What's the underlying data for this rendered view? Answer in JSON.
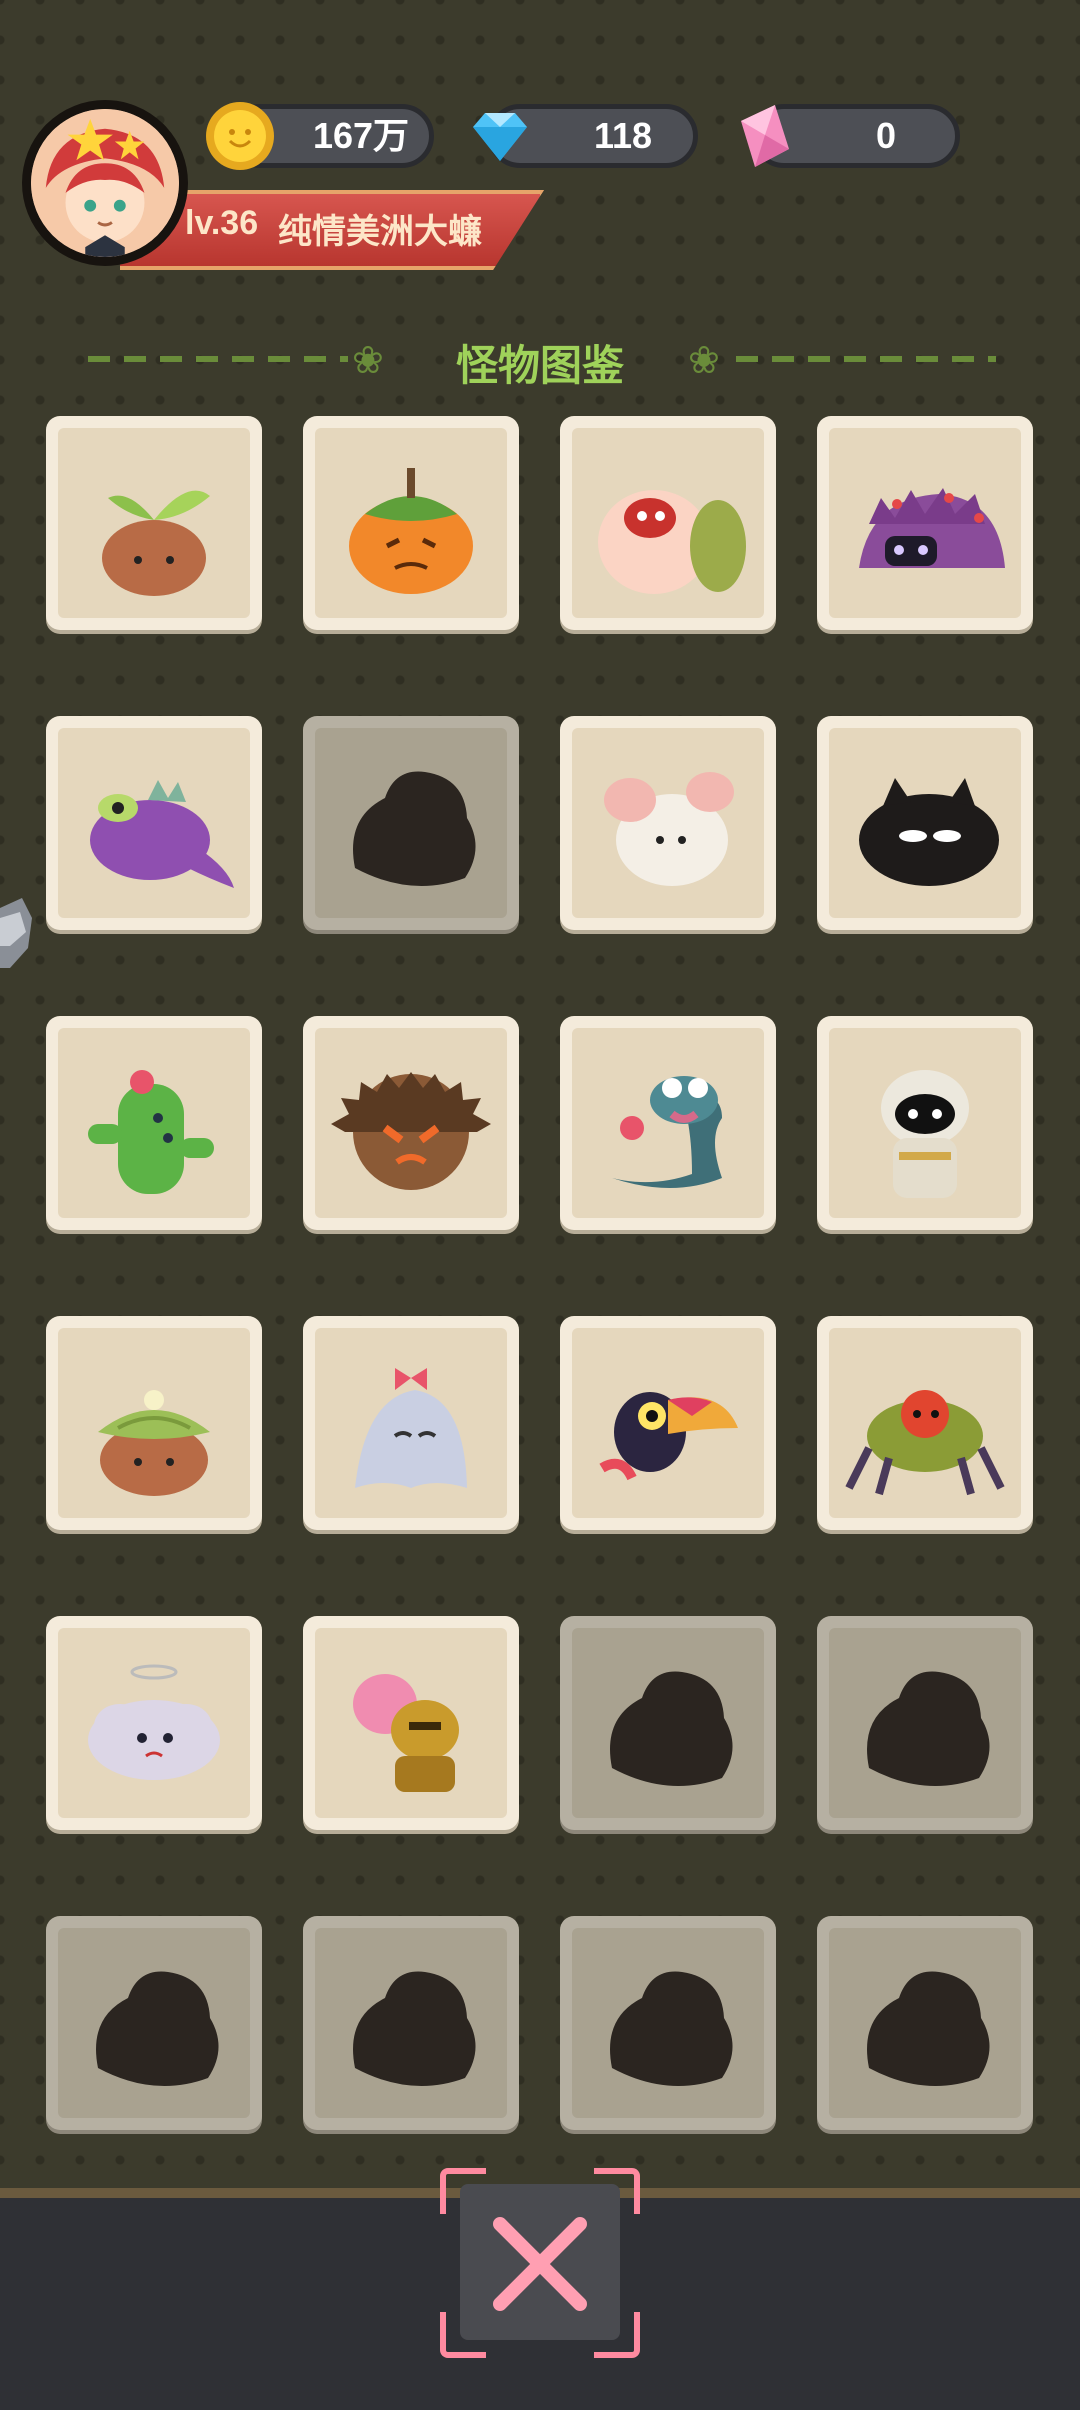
{
  "player": {
    "level": "lv.36",
    "name": "纯情美洲大蠊"
  },
  "currencies": {
    "coins": "167万",
    "diamonds": "118",
    "crystals": "0"
  },
  "page": {
    "title": "怪物图鉴"
  },
  "colors": {
    "title_green": "#9fd25a",
    "banner_red": "#c4413a",
    "close_pink": "#ff8aa0"
  },
  "monsters": [
    {
      "icon": "sprout-mole-icon",
      "unlocked": true
    },
    {
      "icon": "pumpkin-icon",
      "unlocked": true
    },
    {
      "icon": "pig-snail-icon",
      "unlocked": true
    },
    {
      "icon": "berry-hedgehog-icon",
      "unlocked": true
    },
    {
      "icon": "purple-dino-icon",
      "unlocked": true
    },
    {
      "icon": "unknown-monster-icon",
      "unlocked": false
    },
    {
      "icon": "white-mouse-icon",
      "unlocked": true
    },
    {
      "icon": "black-fluff-cat-icon",
      "unlocked": true
    },
    {
      "icon": "cactus-icon",
      "unlocked": true
    },
    {
      "icon": "chestnut-icon",
      "unlocked": true
    },
    {
      "icon": "blue-eel-icon",
      "unlocked": true
    },
    {
      "icon": "mummy-icon",
      "unlocked": true
    },
    {
      "icon": "leaf-mole-icon",
      "unlocked": true
    },
    {
      "icon": "ghost-bow-icon",
      "unlocked": true
    },
    {
      "icon": "toucan-icon",
      "unlocked": true
    },
    {
      "icon": "beetle-icon",
      "unlocked": true
    },
    {
      "icon": "cloud-angel-icon",
      "unlocked": true
    },
    {
      "icon": "knight-icon",
      "unlocked": true
    },
    {
      "icon": "unknown-monster-icon",
      "unlocked": false
    },
    {
      "icon": "unknown-monster-icon",
      "unlocked": false
    },
    {
      "icon": "unknown-monster-icon",
      "unlocked": false
    },
    {
      "icon": "unknown-monster-icon",
      "unlocked": false
    },
    {
      "icon": "unknown-monster-icon",
      "unlocked": false
    },
    {
      "icon": "unknown-monster-icon",
      "unlocked": false
    }
  ]
}
